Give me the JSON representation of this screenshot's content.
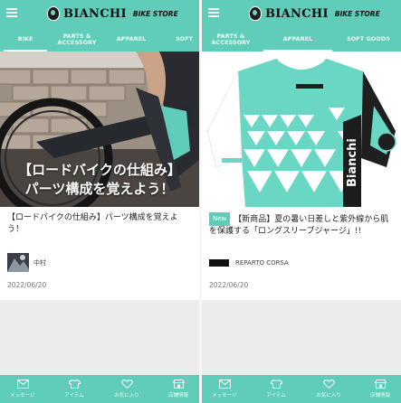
{
  "brand": {
    "name": "BIANCHI",
    "sub": "BIKE STORE",
    "color": "#5fcdb9"
  },
  "left": {
    "tabs": [
      {
        "label": "BIKE",
        "active": true
      },
      {
        "label": "PARTS &\nACCESSORY",
        "active": false
      },
      {
        "label": "APPAREL",
        "active": false
      },
      {
        "label": "SOFT",
        "active": false
      }
    ],
    "article": {
      "hero_line1": "【ロードバイクの仕組み】",
      "hero_line2": "パーツ構成を覚えよう！",
      "title": "【ロードバイクの仕組み】パーツ構成を覚えよう！",
      "author": "中村",
      "date": "2022/06/20"
    }
  },
  "right": {
    "tabs": [
      {
        "label": "PARTS &\nACCESSORY",
        "active": false
      },
      {
        "label": "APPAREL",
        "active": true
      },
      {
        "label": "SOFT GOODS",
        "active": false
      }
    ],
    "article": {
      "badge": "New",
      "title": "【新商品】夏の暑い日差しと紫外線から肌を保護する「ロングスリーブジャージ」!!",
      "author": "REPARTO CORSA",
      "date": "2022/06/20"
    }
  },
  "bottom_nav": [
    {
      "label": "メッセージ",
      "icon": "mail-icon"
    },
    {
      "label": "アイテム",
      "icon": "shirt-icon"
    },
    {
      "label": "お気に入り",
      "icon": "heart-icon"
    },
    {
      "label": "店舗情報",
      "icon": "store-icon"
    }
  ]
}
